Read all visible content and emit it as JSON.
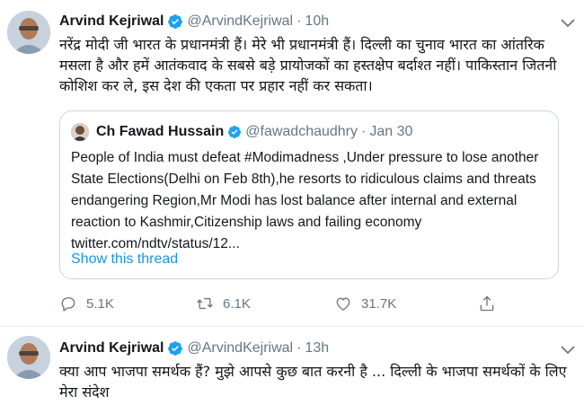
{
  "tweets": [
    {
      "author_name": "Arvind Kejriwal",
      "author_handle": "@ArvindKejriwal",
      "separator": "·",
      "time": "10h",
      "text": "नरेंद्र मोदी जी भारत के प्रधानमंत्री हैं। मेरे भी प्रधानमंत्री हैं। दिल्ली का चुनाव भारत का आंतरिक मसला है और हमें आतंकवाद के सबसे बड़े प्रायोजकों का हस्तक्षेप बर्दाश्त नहीं। पाकिस्तान जितनी कोशिश कर ले, इस देश की एकता पर प्रहार नहीं कर सकता।",
      "quoted": {
        "author_name": "Ch Fawad Hussain",
        "author_handle": "@fawadchaudhry",
        "separator": "·",
        "time": "Jan 30",
        "text": "People of India must defeat #Modimadness ,Under pressure to lose another State Elections(Delhi on Feb 8th),he resorts to ridiculous claims and threats endangering Region,Mr Modi has lost balance after internal and external reaction to Kashmir,Citizenship laws and failing economy twitter.com/ndtv/status/12...",
        "thread_link": "Show this thread"
      },
      "actions": {
        "replies": "5.1K",
        "retweets": "6.1K",
        "likes": "31.7K"
      }
    },
    {
      "author_name": "Arvind Kejriwal",
      "author_handle": "@ArvindKejriwal",
      "separator": "·",
      "time": "13h",
      "text": "क्या आप भाजपा समर्थक हैं? मुझे आपसे कुछ बात करनी है ... दिल्ली के भाजपा समर्थकों के लिए मेरा संदेश"
    }
  ],
  "colors": {
    "verified": "#1da1f2",
    "link": "#1b95e0",
    "muted": "#657786",
    "border": "#ccd6dd"
  },
  "icons": [
    "verified-badge-icon",
    "chevron-down-icon",
    "reply-icon",
    "retweet-icon",
    "like-icon",
    "share-icon"
  ]
}
